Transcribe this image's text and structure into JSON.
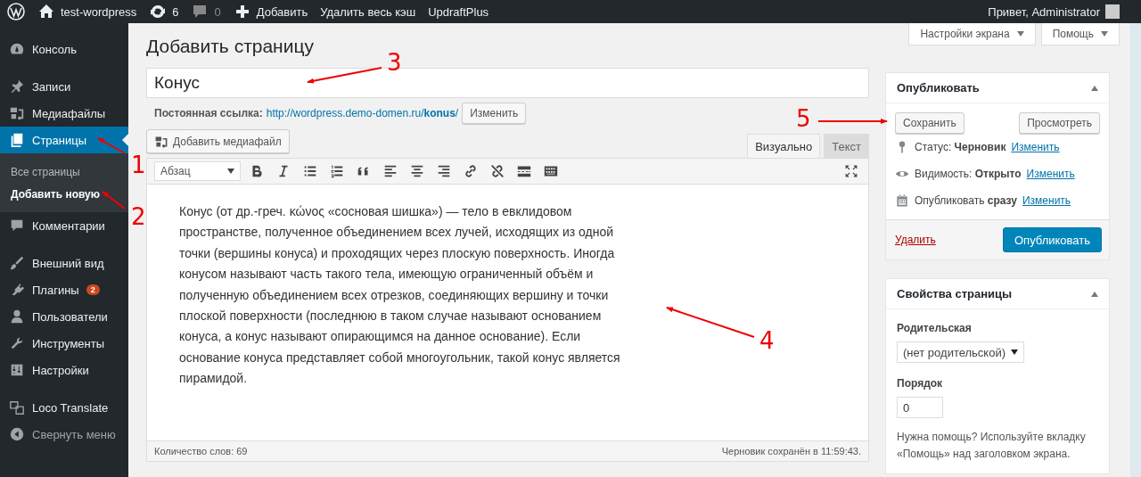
{
  "admin_bar": {
    "items": [
      {
        "kind": "logo"
      },
      {
        "kind": "site",
        "label": "test-wordpress"
      },
      {
        "kind": "updates",
        "label": "6"
      },
      {
        "kind": "comments",
        "label": "0"
      },
      {
        "kind": "new",
        "label": "Добавить"
      },
      {
        "kind": "text",
        "label": "Удалить весь кэш"
      },
      {
        "kind": "text",
        "label": "UpdraftPlus"
      }
    ],
    "greeting": "Привет, Administrator"
  },
  "sidebar": {
    "items": [
      {
        "kind": "item",
        "label": "Консоль",
        "selected": false
      },
      {
        "kind": "gap"
      },
      {
        "kind": "item",
        "label": "Записи",
        "selected": false
      },
      {
        "kind": "item",
        "label": "Медиафайлы",
        "selected": false
      },
      {
        "kind": "item",
        "label": "Страницы",
        "selected": true,
        "children": [
          {
            "label": "Все страницы",
            "selected": false
          },
          {
            "label": "Добавить новую",
            "selected": true
          }
        ]
      },
      {
        "kind": "item",
        "label": "Комментарии",
        "selected": false
      },
      {
        "kind": "gap"
      },
      {
        "kind": "item",
        "label": "Внешний вид",
        "selected": false
      },
      {
        "kind": "item",
        "label": "Плагины",
        "selected": false,
        "badge": "2"
      },
      {
        "kind": "item",
        "label": "Пользователи",
        "selected": false
      },
      {
        "kind": "item",
        "label": "Инструменты",
        "selected": false
      },
      {
        "kind": "item",
        "label": "Настройки",
        "selected": false
      },
      {
        "kind": "gap"
      },
      {
        "kind": "item",
        "label": "Loco Translate",
        "selected": false
      },
      {
        "kind": "collapse",
        "label": "Свернуть меню",
        "selected": false
      }
    ]
  },
  "screen_tabs": [
    "Настройки экрана",
    "Помощь"
  ],
  "page_title": "Добавить страницу",
  "title_field": {
    "value": "Конус"
  },
  "permalink": {
    "label": "Постоянная ссылка:",
    "url": "http://wordpress.demo-domen.ru/**konus**/",
    "button": "Изменить"
  },
  "media_button": "Добавить медиафайл",
  "editor_tabs": [
    {
      "label": "Визуально",
      "selected": true
    },
    {
      "label": "Текст",
      "selected": false
    }
  ],
  "format_select": "Абзац",
  "content": "Конус (от др.-греч. κώνος «сосновая шишка») — тело в евклидовом пространстве, полученное объединением всех лучей, исходящих из одной точки (вершины конуса) и проходящих через плоскую поверхность. Иногда конусом называют часть такого тела, имеющую ограниченный объём и полученную объединением всех отрезков, соединяющих вершину и точки плоской поверхности (последнюю в таком случае называют основанием конуса, а конус называют опирающимся на данное основание). Если основание конуса представляет собой многоугольник, такой конус является пирамидой.",
  "status_bar": {
    "word_count": "Количество слов: 69",
    "saved": "Черновик сохранён в 11:59:43."
  },
  "publish_box": {
    "title": "Опубликовать",
    "save": "Сохранить",
    "preview": "Просмотреть",
    "rows": [
      {
        "text": "Статус: **Черновик**",
        "link": "Изменить"
      },
      {
        "text": "Видимость: **Открыто**",
        "link": "Изменить"
      },
      {
        "text": "Опубликовать **сразу**",
        "link": "Изменить"
      }
    ],
    "delete": "Удалить",
    "publish": "Опубликовать"
  },
  "attributes_box": {
    "title": "Свойства страницы",
    "parent_label": "Родительская",
    "parent_value": "(нет родительской)",
    "order_label": "Порядок",
    "order_value": "0",
    "help": "Нужна помощь? Используйте вкладку «Помощь» над заголовком экрана."
  },
  "annotations": [
    {
      "label": "1"
    },
    {
      "label": "2"
    },
    {
      "label": "3"
    },
    {
      "label": "4"
    },
    {
      "label": "5"
    }
  ]
}
